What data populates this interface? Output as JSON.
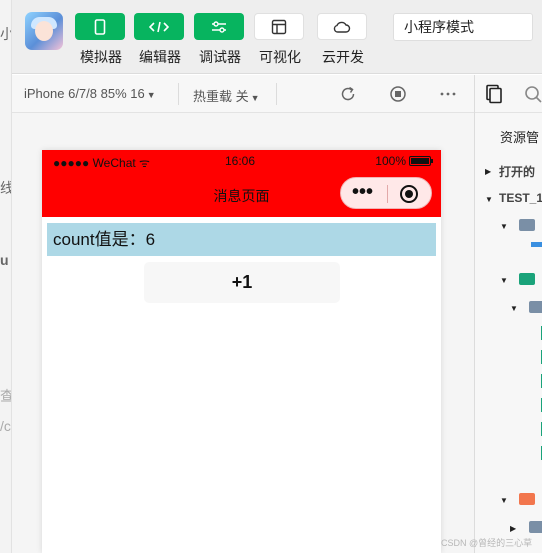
{
  "left_strip": {
    "fragments": [
      "小",
      "线",
      "u",
      "查",
      "/c"
    ]
  },
  "toolbar": {
    "tools": [
      {
        "label": "模拟器",
        "icon": "phone-icon"
      },
      {
        "label": "编辑器",
        "icon": "code-icon"
      },
      {
        "label": "调试器",
        "icon": "sliders-icon"
      },
      {
        "label": "可视化",
        "icon": "layout-icon"
      },
      {
        "label": "云开发",
        "icon": "cloud-icon"
      }
    ],
    "mode": "小程序模式",
    "accent_color": "#07b45f"
  },
  "subbar": {
    "device": "iPhone 6/7/8 85% 16",
    "hot_reload": "热重载 关"
  },
  "simulator": {
    "status": {
      "carrier": "●●●●● WeChat",
      "time": "16:06",
      "battery": "100%"
    },
    "nav_title": "消息页面",
    "nav_color": "#ff0000",
    "count_text": "count值是：6",
    "count_bg": "#add8e6",
    "button_label": "+1"
  },
  "explorer": {
    "title": "资源管",
    "open_editors": "打开的",
    "project": "TEST_1"
  },
  "watermark": "CSDN @曾经的三心草"
}
